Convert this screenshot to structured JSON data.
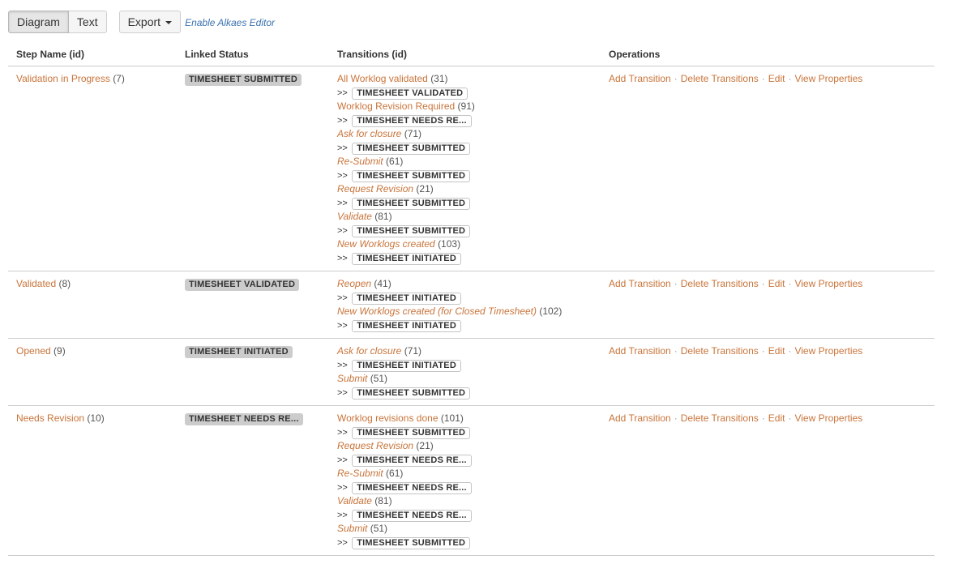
{
  "toolbar": {
    "diagram_label": "Diagram",
    "text_label": "Text",
    "export_label": "Export",
    "alkaes_label": "Enable Alkaes Editor"
  },
  "columns": [
    "Step Name (id)",
    "Linked Status",
    "Transitions (id)",
    "Operations"
  ],
  "operations": [
    "Add Transition",
    "Delete Transitions",
    "Edit",
    "View Properties"
  ],
  "arrow": ">>",
  "steps": [
    {
      "name": "Validation in Progress",
      "id": "(7)",
      "status": "TIMESHEET SUBMITTED",
      "transitions": [
        {
          "name": "All Worklog validated",
          "id": "(31)",
          "italic": false,
          "target": "TIMESHEET VALIDATED"
        },
        {
          "name": "Worklog Revision Required",
          "id": "(91)",
          "italic": false,
          "target": "TIMESHEET NEEDS RE..."
        },
        {
          "name": "Ask for closure",
          "id": "(71)",
          "italic": true,
          "target": "TIMESHEET SUBMITTED"
        },
        {
          "name": "Re-Submit",
          "id": "(61)",
          "italic": true,
          "target": "TIMESHEET SUBMITTED"
        },
        {
          "name": "Request Revision",
          "id": "(21)",
          "italic": true,
          "target": "TIMESHEET SUBMITTED"
        },
        {
          "name": "Validate",
          "id": "(81)",
          "italic": true,
          "target": "TIMESHEET SUBMITTED"
        },
        {
          "name": "New Worklogs created",
          "id": "(103)",
          "italic": true,
          "target": "TIMESHEET INITIATED"
        }
      ]
    },
    {
      "name": "Validated",
      "id": "(8)",
      "status": "TIMESHEET VALIDATED",
      "transitions": [
        {
          "name": "Reopen",
          "id": "(41)",
          "italic": true,
          "target": "TIMESHEET INITIATED"
        },
        {
          "name": "New Worklogs created (for Closed Timesheet)",
          "id": "(102)",
          "italic": true,
          "target": "TIMESHEET INITIATED"
        }
      ]
    },
    {
      "name": "Opened",
      "id": "(9)",
      "status": "TIMESHEET INITIATED",
      "transitions": [
        {
          "name": "Ask for closure",
          "id": "(71)",
          "italic": true,
          "target": "TIMESHEET INITIATED"
        },
        {
          "name": "Submit",
          "id": "(51)",
          "italic": true,
          "target": "TIMESHEET SUBMITTED"
        }
      ]
    },
    {
      "name": "Needs Revision",
      "id": "(10)",
      "status": "TIMESHEET NEEDS RE...",
      "transitions": [
        {
          "name": "Worklog revisions done",
          "id": "(101)",
          "italic": false,
          "target": "TIMESHEET SUBMITTED"
        },
        {
          "name": "Request Revision",
          "id": "(21)",
          "italic": true,
          "target": "TIMESHEET NEEDS RE..."
        },
        {
          "name": "Re-Submit",
          "id": "(61)",
          "italic": true,
          "target": "TIMESHEET NEEDS RE..."
        },
        {
          "name": "Validate",
          "id": "(81)",
          "italic": true,
          "target": "TIMESHEET NEEDS RE..."
        },
        {
          "name": "Submit",
          "id": "(51)",
          "italic": true,
          "target": "TIMESHEET SUBMITTED"
        }
      ]
    }
  ]
}
